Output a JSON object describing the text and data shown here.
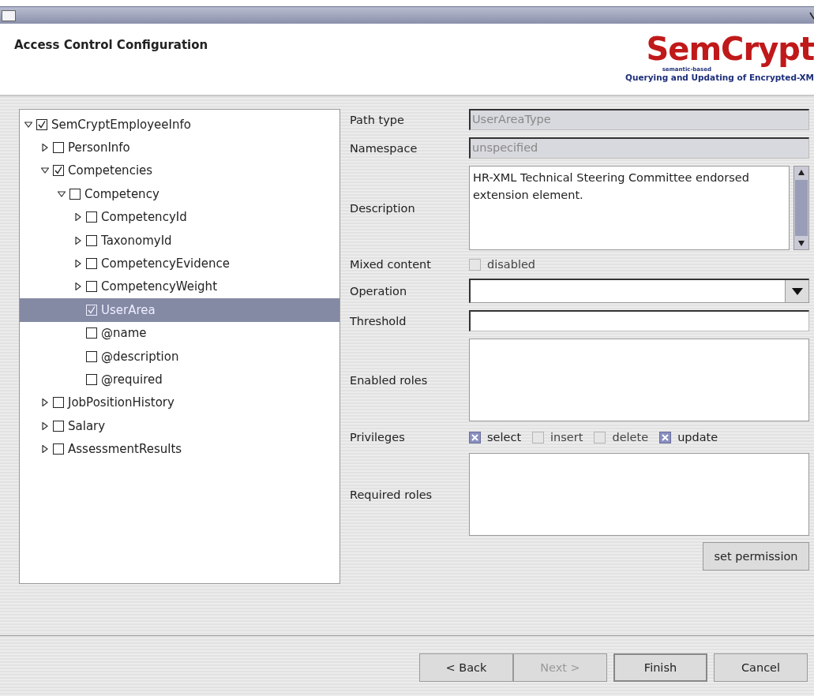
{
  "header": {
    "title": "Access Control Configuration",
    "logo": {
      "name": "SemCrypt",
      "tagline": "semantic-based",
      "subtitle": "Querying and Updating of Encrypted-XM"
    }
  },
  "tree": [
    {
      "label": "SemCryptEmployeeInfo",
      "checked": true,
      "expanded": true,
      "selected": false,
      "children": [
        {
          "label": "PersonInfo",
          "checked": false,
          "expanded": false,
          "selected": false
        },
        {
          "label": "Competencies",
          "checked": true,
          "expanded": true,
          "selected": false,
          "children": [
            {
              "label": "Competency",
              "checked": false,
              "expanded": true,
              "selected": false,
              "children": [
                {
                  "label": "CompetencyId",
                  "checked": false,
                  "expanded": false,
                  "selected": false
                },
                {
                  "label": "TaxonomyId",
                  "checked": false,
                  "expanded": false,
                  "selected": false
                },
                {
                  "label": "CompetencyEvidence",
                  "checked": false,
                  "expanded": false,
                  "selected": false
                },
                {
                  "label": "CompetencyWeight",
                  "checked": false,
                  "expanded": false,
                  "selected": false
                },
                {
                  "label": "UserArea",
                  "checked": true,
                  "selected": true
                },
                {
                  "label": "@name",
                  "checked": false,
                  "selected": false
                },
                {
                  "label": "@description",
                  "checked": false,
                  "selected": false
                },
                {
                  "label": "@required",
                  "checked": false,
                  "selected": false
                }
              ]
            }
          ]
        },
        {
          "label": "JobPositionHistory",
          "checked": false,
          "expanded": false,
          "selected": false
        },
        {
          "label": "Salary",
          "checked": false,
          "expanded": false,
          "selected": false
        },
        {
          "label": "AssessmentResults",
          "checked": false,
          "expanded": false,
          "selected": false
        }
      ]
    }
  ],
  "form": {
    "rows": [
      {
        "kind": "text",
        "label": "Path type",
        "value": "UserAreaType",
        "disabled": true
      },
      {
        "kind": "text",
        "label": "Namespace",
        "value": "unspecified",
        "disabled": true
      },
      {
        "kind": "textarea",
        "label": "Description",
        "value": "HR-XML Technical Steering Committee endorsed extension element."
      },
      {
        "kind": "checkbox",
        "label": "Mixed content",
        "options": [
          {
            "label": "disabled",
            "checked": false
          }
        ]
      },
      {
        "kind": "combo",
        "label": "Operation"
      },
      {
        "kind": "text",
        "label": "Threshold",
        "disabled": false
      },
      {
        "kind": "list",
        "label": "Enabled roles"
      },
      {
        "kind": "checkbox",
        "label": "Privileges",
        "options": [
          {
            "label": "select",
            "checked": true
          },
          {
            "label": "insert",
            "checked": false
          },
          {
            "label": "delete",
            "checked": false
          },
          {
            "label": "update",
            "checked": true
          }
        ]
      },
      {
        "kind": "list",
        "label": "Required roles"
      }
    ],
    "action": "set permission"
  },
  "buttons": [
    {
      "label": "< Back",
      "disabled": false,
      "default": false
    },
    {
      "label": "Next >",
      "disabled": true,
      "default": false
    },
    {
      "label": "Finish",
      "disabled": false,
      "default": true
    },
    {
      "label": "Cancel",
      "disabled": false,
      "default": false
    }
  ]
}
